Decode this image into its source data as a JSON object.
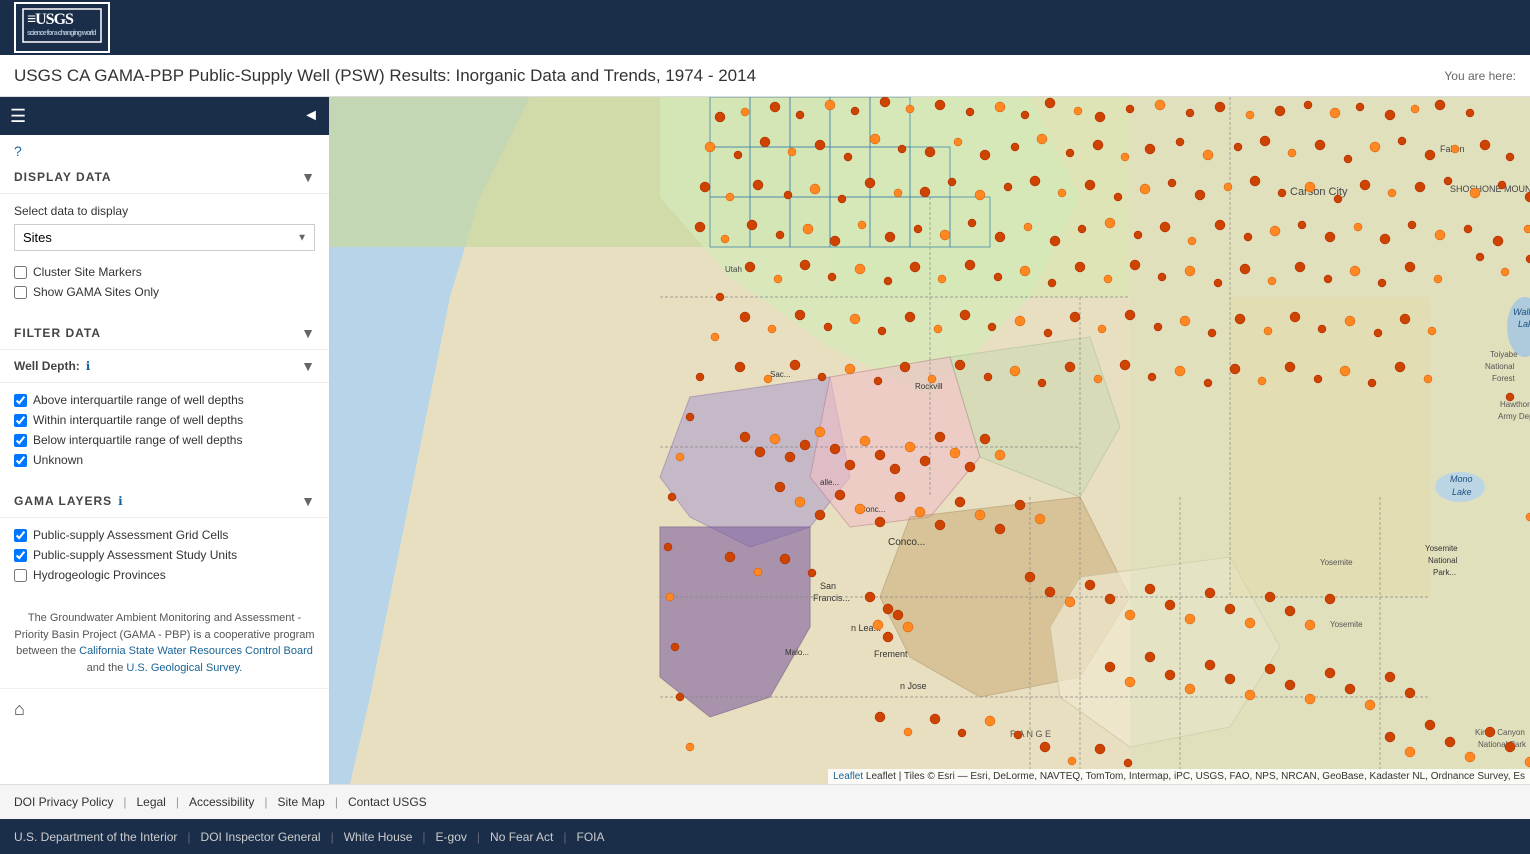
{
  "header": {
    "logo_usgs": "≡USGS",
    "logo_tagline": "science for a changing world"
  },
  "title_bar": {
    "title": "USGS CA GAMA-PBP Public-Supply Well (PSW) Results: Inorganic Data and Trends, 1974 - 2014",
    "you_are_here_label": "You are here:"
  },
  "sidebar": {
    "display_data_label": "DISPLAY DATA",
    "select_data_label": "Select data to display",
    "select_option": "Sites",
    "cluster_label": "Cluster Site Markers",
    "gama_only_label": "Show GAMA Sites Only",
    "filter_data_label": "FILTER DATA",
    "well_depth_label": "Well Depth:",
    "above_iqr": "Above interquartile range of well depths",
    "within_iqr": "Within interquartile range of well depths",
    "below_iqr": "Below interquartile range of well depths",
    "unknown": "Unknown",
    "gama_layers_label": "GAMA LAYERS",
    "layer1": "Public-supply Assessment Grid Cells",
    "layer2": "Public-supply Assessment Study Units",
    "layer3": "Hydrogeologic Provinces",
    "description": "The Groundwater Ambient Monitoring and Assessment - Priority Basin Project (GAMA - PBP) is a cooperative program between the",
    "link1": "California State Water Resources Control Board",
    "and_text": "and the",
    "link2": "U.S. Geological Survey."
  },
  "map": {
    "attribution": "Leaflet | Tiles © Esri — Esri, DeLorme, NAVTEQ, TomTom, Intermap, iPC, USGS, FAO, NPS, NRCAN, GeoBase, Kadaster NL, Ordnance Survey, Es"
  },
  "footer1": {
    "items": [
      {
        "label": "DOI Privacy Policy",
        "id": "doi-privacy"
      },
      {
        "label": "Legal",
        "id": "legal"
      },
      {
        "label": "Accessibility",
        "id": "accessibility"
      },
      {
        "label": "Site Map",
        "id": "site-map"
      },
      {
        "label": "Contact USGS",
        "id": "contact-usgs"
      }
    ]
  },
  "footer2": {
    "items": [
      {
        "label": "U.S. Department of the Interior",
        "id": "doi"
      },
      {
        "label": "DOI Inspector General",
        "id": "doi-ig"
      },
      {
        "label": "White House",
        "id": "white-house"
      },
      {
        "label": "E-gov",
        "id": "e-gov"
      },
      {
        "label": "No Fear Act",
        "id": "no-fear-act"
      },
      {
        "label": "FOIA",
        "id": "foia"
      }
    ]
  }
}
